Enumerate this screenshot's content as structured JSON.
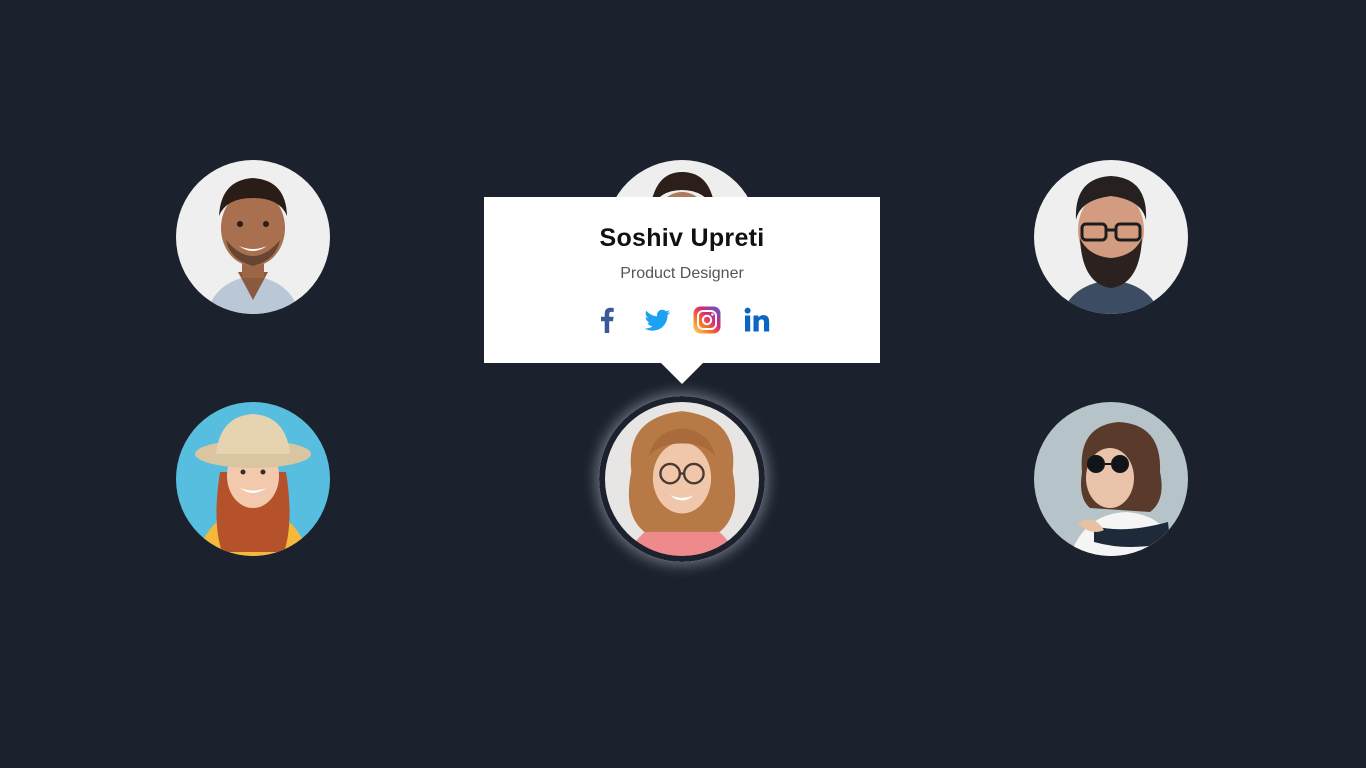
{
  "tooltip": {
    "name": "Soshiv Upreti",
    "role": "Product Designer"
  },
  "socials": [
    {
      "icon": "facebook-icon",
      "color": "#3b5998"
    },
    {
      "icon": "twitter-icon",
      "color": "#1da1f2"
    },
    {
      "icon": "instagram-icon",
      "color": "#e1306c"
    },
    {
      "icon": "linkedin-icon",
      "color": "#0a66c2"
    }
  ],
  "colors": {
    "background": "#1b212d",
    "tooltip_bg": "#ffffff"
  }
}
